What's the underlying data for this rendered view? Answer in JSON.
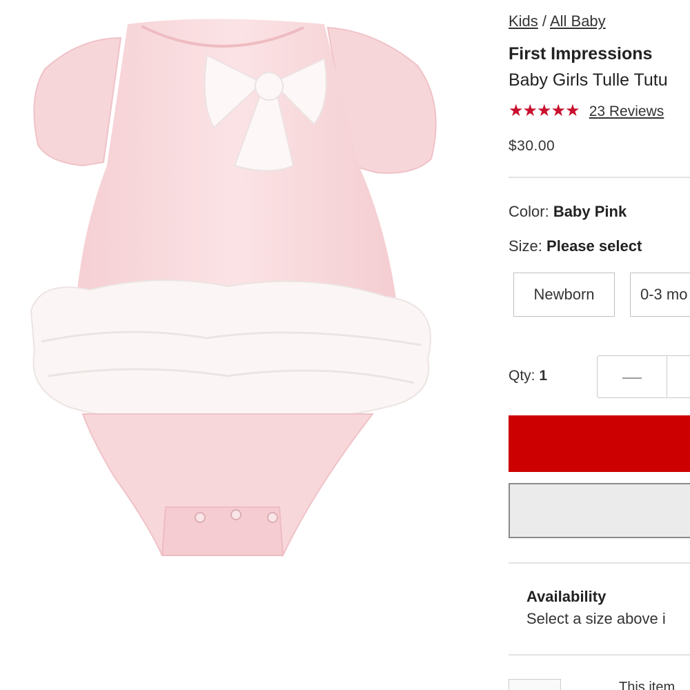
{
  "breadcrumb": {
    "items": [
      "Kids",
      "All Baby"
    ],
    "separator": "/"
  },
  "product": {
    "brand": "First Impressions",
    "name": "Baby Girls Tulle Tutu",
    "stars": "★★★★★",
    "rating_out_of_5": 5,
    "reviews_label": "23 Reviews",
    "price": "$30.00"
  },
  "color": {
    "label": "Color:",
    "value": "Baby Pink"
  },
  "size": {
    "label": "Size:",
    "value": "Please select",
    "options": [
      "Newborn",
      "0-3 mo"
    ]
  },
  "quantity": {
    "label": "Qty:",
    "value": "1",
    "decrement": "—"
  },
  "availability": {
    "title": "Availability",
    "text": "Select a size above i"
  },
  "footer": {
    "item_text": "This item"
  },
  "colors": {
    "accent": "#cc0000",
    "star": "#c8102e",
    "product_pink": "#f8d7da"
  }
}
